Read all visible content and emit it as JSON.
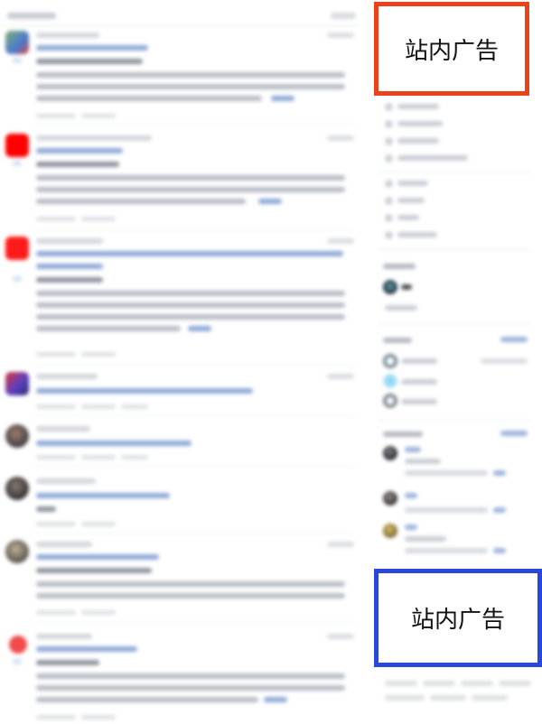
{
  "sidebar": {
    "ad_top": {
      "label": "站内广告",
      "border_color": "#e8431a"
    },
    "ad_bottom": {
      "label": "站内广告",
      "border_color": "#2b47d8"
    }
  },
  "feed": {
    "avatar_colors": [
      "#6a8fd0",
      "#ff0000",
      "#ff1a1a",
      "#6b4fc2",
      "#5b5555",
      "#4d4a4a",
      "#7d7466",
      "#f04a4a"
    ]
  }
}
